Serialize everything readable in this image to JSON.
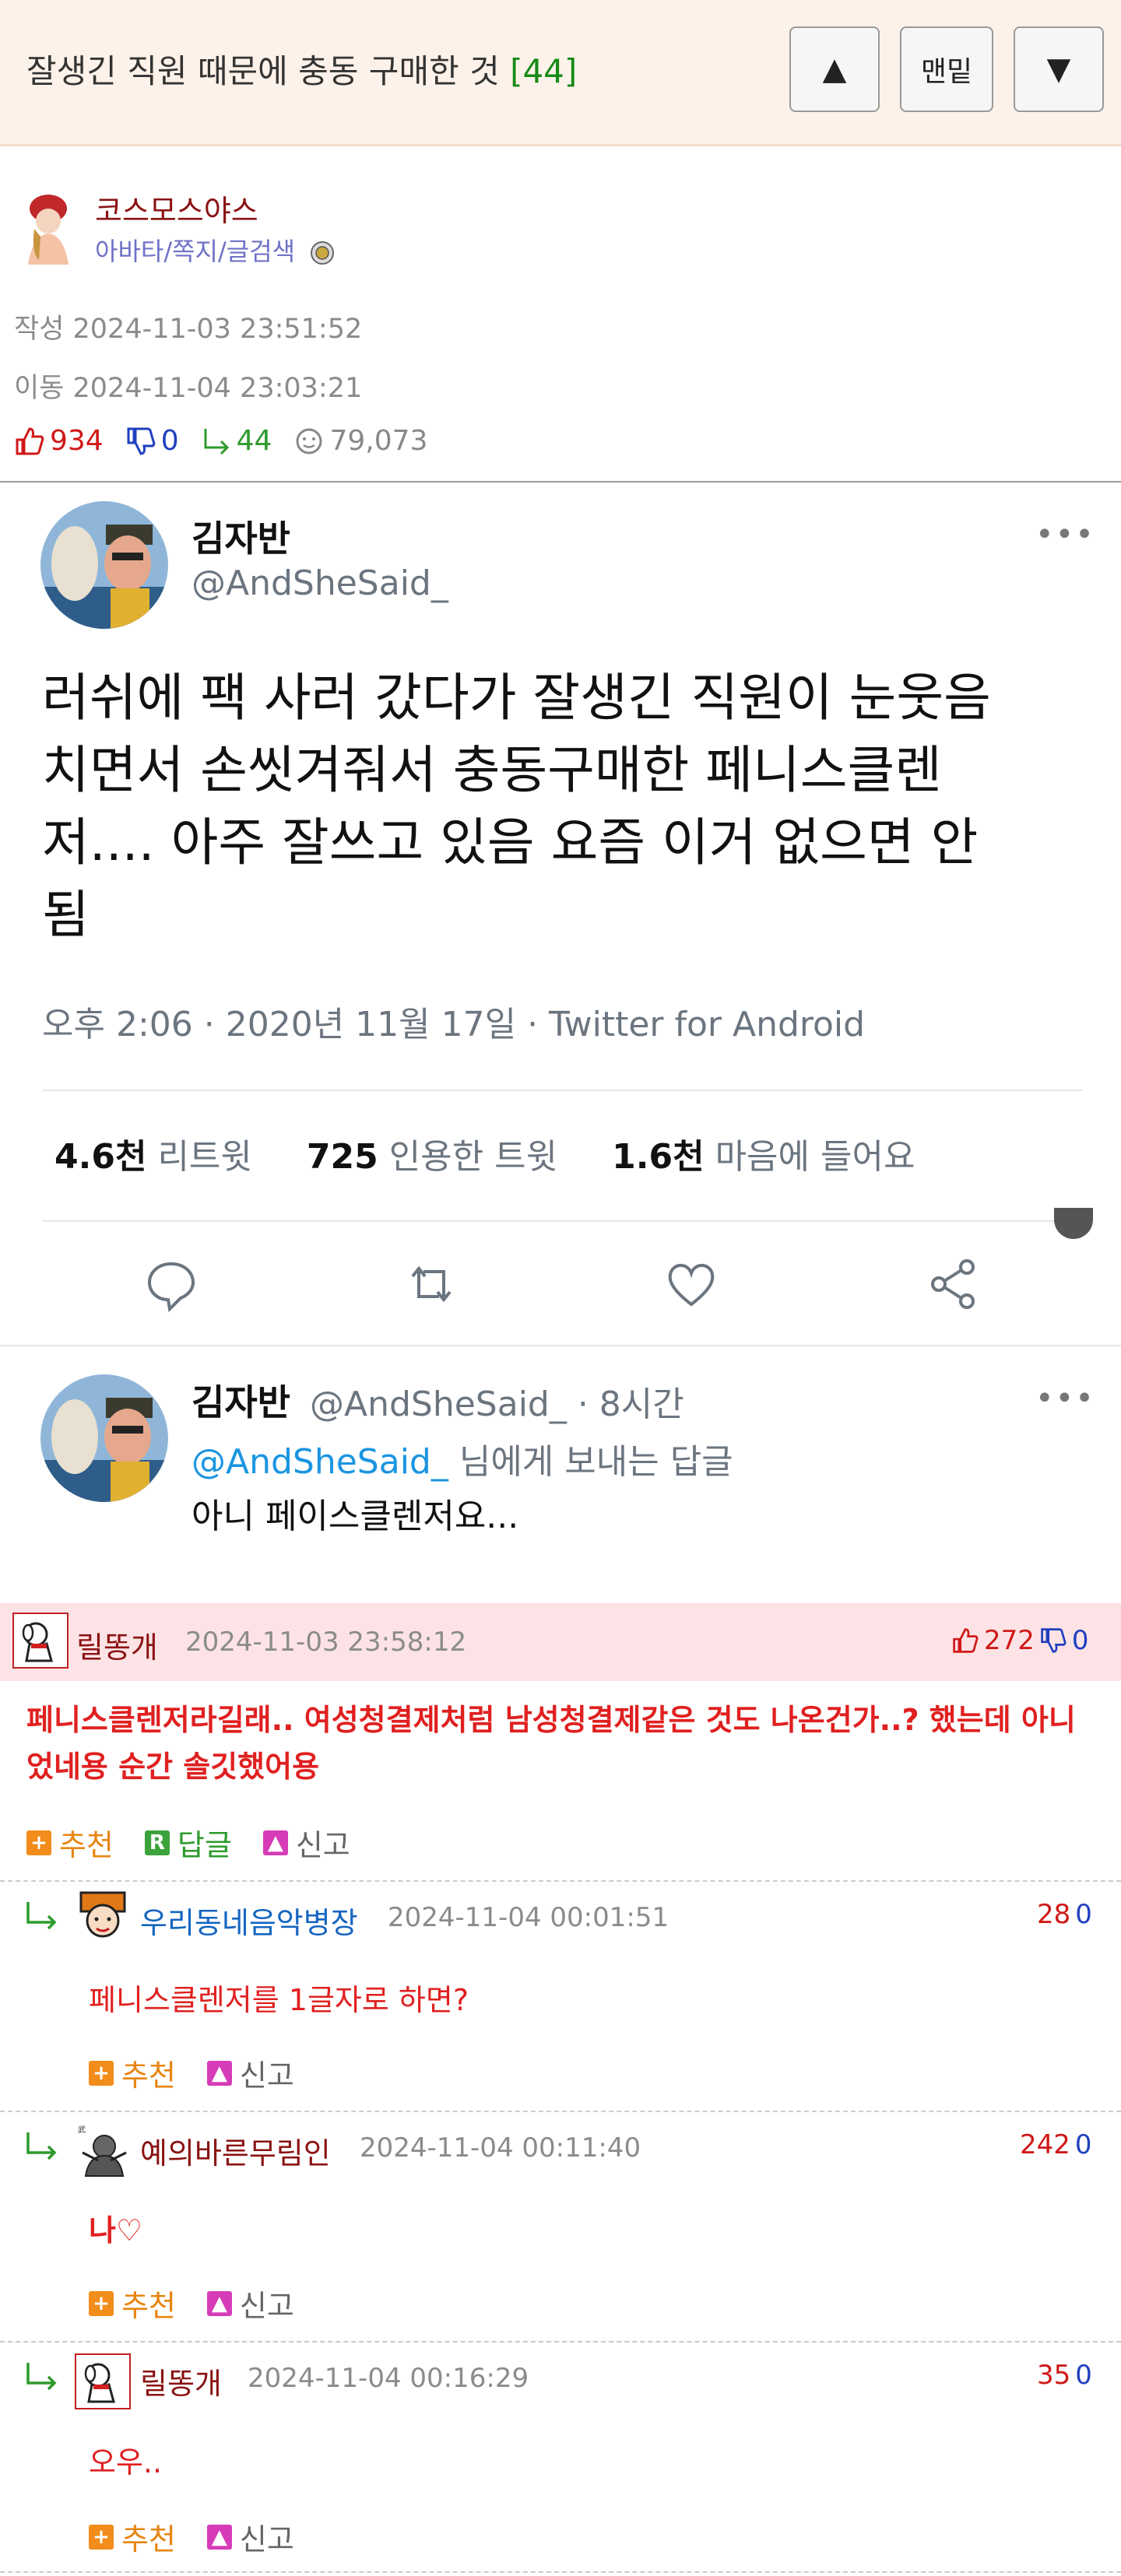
{
  "header": {
    "title": "잘생긴 직원 때문에 충동 구매한 것",
    "comment_count": "[44]",
    "btn_up": "▲",
    "btn_bottom": "맨밑",
    "btn_down": "▼"
  },
  "author": {
    "name": "코스모스야스",
    "links": "아바타/쪽지/글검색",
    "created": "작성 2024-11-03 23:51:52",
    "moved": "이동 2024-11-04 23:03:21"
  },
  "stats": {
    "likes": "934",
    "dislikes": "0",
    "replies": "44",
    "views": "79,073"
  },
  "tweet": {
    "name": "김자반",
    "handle": "@AndSheSaid_",
    "body_lines": [
      "러쉬에 팩 사러 갔다가 잘생긴 직원이 눈웃음",
      "치면서 손씻겨줘서 충동구매한 페니스클렌",
      "저.... 아주 잘쓰고 있음 요즘 이거 없으면 안",
      "됨"
    ],
    "time": "오후 2:06 · 2020년 11월 17일 · Twitter for Android",
    "retweets_num": "4.6천",
    "retweets_lbl": "리트윗",
    "quotes_num": "725",
    "quotes_lbl": "인용한 트윗",
    "likes_num": "1.6천",
    "likes_lbl": "마음에 들어요",
    "more": "•••",
    "reply": {
      "name": "김자반",
      "handle_time": "@AndSheSaid_ · 8시간",
      "to_handle": "@AndSheSaid_",
      "to_suffix": " 님에게 보내는 답글",
      "text": "아니 페이스클렌저요..."
    }
  },
  "comments": {
    "best": {
      "user": "릴똥개",
      "date": "2024-11-03 23:58:12",
      "up": "272",
      "down": "0",
      "text_line1": "페니스클렌저라길래.. 여성청결제처럼 남성청결제같은 것도 나온건가..? 했는데 아니",
      "text_line2": "었네용 순간 솔깃했어용",
      "recommend": "추천",
      "reply": "답글",
      "report": "신고"
    },
    "replies": [
      {
        "user": "우리동네음악병장",
        "date": "2024-11-04 00:01:51",
        "up": "28",
        "down": "0",
        "text": "페니스클렌저를 1글자로 하면?",
        "recommend": "추천",
        "report": "신고"
      },
      {
        "user": "예의바른무림인",
        "date": "2024-11-04 00:11:40",
        "up": "242",
        "down": "0",
        "text": "나♡",
        "recommend": "추천",
        "report": "신고"
      },
      {
        "user": "릴똥개",
        "date": "2024-11-04 00:16:29",
        "up": "35",
        "down": "0",
        "text": "오우..",
        "recommend": "추천",
        "report": "신고"
      }
    ]
  },
  "colors": {
    "header_bg": "#fdf2e9",
    "best_bg": "#fde3e5",
    "comment_red": "#e02020",
    "link_purple": "#6f72c7",
    "twitter_blue": "#1b95e0"
  }
}
